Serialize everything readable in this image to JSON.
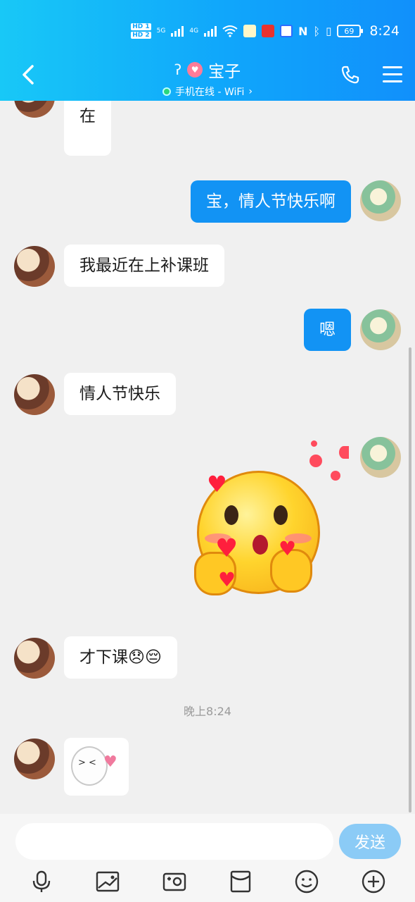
{
  "status_bar": {
    "hd1": "HD 1",
    "hd2": "HD 2",
    "net1": "5G",
    "net2": "4G",
    "battery": "69",
    "time": "8:24"
  },
  "header": {
    "title": "宝子",
    "status": "手机在线 - WiFi",
    "status_color": "#2bd67b"
  },
  "messages": [
    {
      "side": "left",
      "text": "在"
    },
    {
      "side": "right",
      "text": "宝，情人节快乐啊"
    },
    {
      "side": "left",
      "text": "我最近在上补课班"
    },
    {
      "side": "right",
      "text": "嗯"
    },
    {
      "side": "left",
      "text": "情人节快乐"
    },
    {
      "side": "right",
      "type": "sticker",
      "sticker": "kissing-face-hearts-emoji"
    },
    {
      "side": "left",
      "text": "才下课😞😔"
    },
    {
      "side": "left",
      "type": "sticker",
      "sticker": "blushing-blob-heart-sticker"
    }
  ],
  "time_separator": "晚上8:24",
  "composer": {
    "input_value": "",
    "send_label": "发送"
  },
  "toolbar_icons": [
    "microphone-icon",
    "image-icon",
    "camera-icon",
    "red-packet-icon",
    "emoji-icon",
    "plus-icon"
  ],
  "colors": {
    "header_gradient_start": "#18c8f7",
    "header_gradient_end": "#1190fb",
    "bubble_right": "#1293f4",
    "bubble_left": "#ffffff",
    "send_button": "#8bcbf6"
  }
}
